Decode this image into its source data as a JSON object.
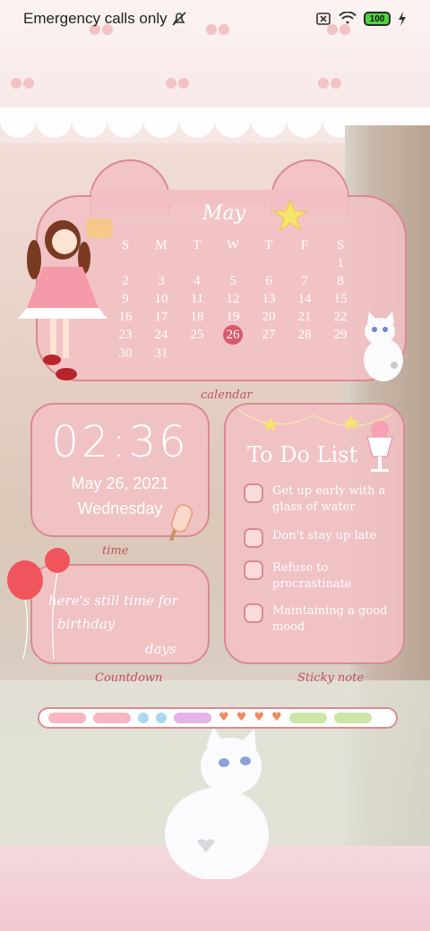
{
  "status_bar": {
    "carrier_text": "Emergency calls only",
    "battery": "100",
    "icons": [
      "no-sim-icon",
      "wifi-icon",
      "battery-icon",
      "charging-icon",
      "notification-off-icon"
    ]
  },
  "calendar": {
    "month": "May",
    "weekdays": [
      "S",
      "M",
      "T",
      "W",
      "T",
      "F",
      "S"
    ],
    "days": [
      "",
      "",
      "",
      "",
      "",
      "",
      "1",
      "2",
      "3",
      "4",
      "5",
      "6",
      "7",
      "8",
      "9",
      "10",
      "11",
      "12",
      "13",
      "14",
      "15",
      "16",
      "17",
      "18",
      "19",
      "20",
      "21",
      "22",
      "23",
      "24",
      "25",
      "26",
      "27",
      "28",
      "29",
      "30",
      "31",
      "",
      "",
      "",
      "",
      ""
    ],
    "today": "26",
    "label": "calendar"
  },
  "time_widget": {
    "clock": "02:36",
    "date": "May 26, 2021",
    "weekday": "Wednesday",
    "label": "time"
  },
  "countdown": {
    "line1": "here's still time for",
    "line2": "birthday",
    "line3": "days",
    "label": "Countdown"
  },
  "todo": {
    "title": "To Do List",
    "items": [
      "Get up early with a glass of water",
      "Don't stay up late",
      "Refuse to procrastinate",
      "Maintaining a good mood"
    ],
    "label": "Sticky note"
  },
  "colors": {
    "panel": "#f2c0c4",
    "border": "#d98a92",
    "today": "#d55a6b",
    "label_text": "#c0535f"
  },
  "deco_bar": {
    "colors": [
      "#f7b6c2",
      "#f7b6c2",
      "#a9d8f0",
      "#a9d8f0",
      "#e3b4e6",
      "#f08a5d",
      "#f08a5d",
      "#f08a5d",
      "#f08a5d",
      "#cde6a8",
      "#cde6a8"
    ]
  }
}
